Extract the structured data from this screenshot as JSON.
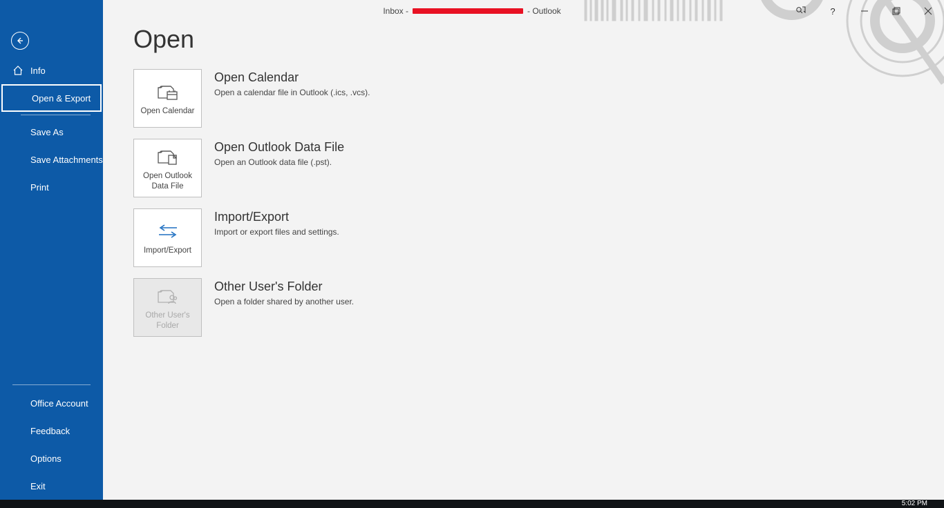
{
  "titlebar": {
    "prefix": "Inbox -",
    "suffix": "- Outlook"
  },
  "sidebar": {
    "info": "Info",
    "open_export": "Open & Export",
    "save_as": "Save As",
    "save_attachments": "Save Attachments",
    "print": "Print",
    "office_account": "Office Account",
    "feedback": "Feedback",
    "options": "Options",
    "exit": "Exit"
  },
  "main": {
    "heading": "Open",
    "options": [
      {
        "tile_label": "Open Calendar",
        "title": "Open Calendar",
        "desc": "Open a calendar file in Outlook (.ics, .vcs)."
      },
      {
        "tile_label": "Open Outlook Data File",
        "title": "Open Outlook Data File",
        "desc": "Open an Outlook data file (.pst)."
      },
      {
        "tile_label": "Import/Export",
        "title": "Import/Export",
        "desc": "Import or export files and settings."
      },
      {
        "tile_label": "Other User's Folder",
        "title": "Other User's Folder",
        "desc": "Open a folder shared by another user."
      }
    ]
  },
  "taskbar": {
    "time": "5:02 PM"
  }
}
